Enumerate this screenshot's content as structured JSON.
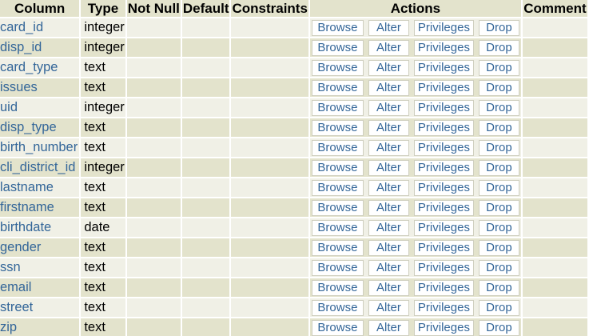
{
  "headers": {
    "column": "Column",
    "type": "Type",
    "not_null": "Not Null",
    "default": "Default",
    "constraints": "Constraints",
    "actions": "Actions",
    "comment": "Comment"
  },
  "actions": {
    "browse": "Browse",
    "alter": "Alter",
    "privileges": "Privileges",
    "drop": "Drop"
  },
  "colors": {
    "header_bg": "#e3e3cc",
    "row_light": "#f0f0e6",
    "row_dark": "#e3e3cc",
    "link": "#336699"
  },
  "rows": [
    {
      "name": "card_id",
      "type": "integer"
    },
    {
      "name": "disp_id",
      "type": "integer"
    },
    {
      "name": "card_type",
      "type": "text"
    },
    {
      "name": "issues",
      "type": "text"
    },
    {
      "name": "uid",
      "type": "integer"
    },
    {
      "name": "disp_type",
      "type": "text"
    },
    {
      "name": "birth_number",
      "type": "text"
    },
    {
      "name": "cli_district_id",
      "type": "integer"
    },
    {
      "name": "lastname",
      "type": "text"
    },
    {
      "name": "firstname",
      "type": "text"
    },
    {
      "name": "birthdate",
      "type": "date"
    },
    {
      "name": "gender",
      "type": "text"
    },
    {
      "name": "ssn",
      "type": "text"
    },
    {
      "name": "email",
      "type": "text"
    },
    {
      "name": "street",
      "type": "text"
    },
    {
      "name": "zip",
      "type": "text"
    }
  ]
}
